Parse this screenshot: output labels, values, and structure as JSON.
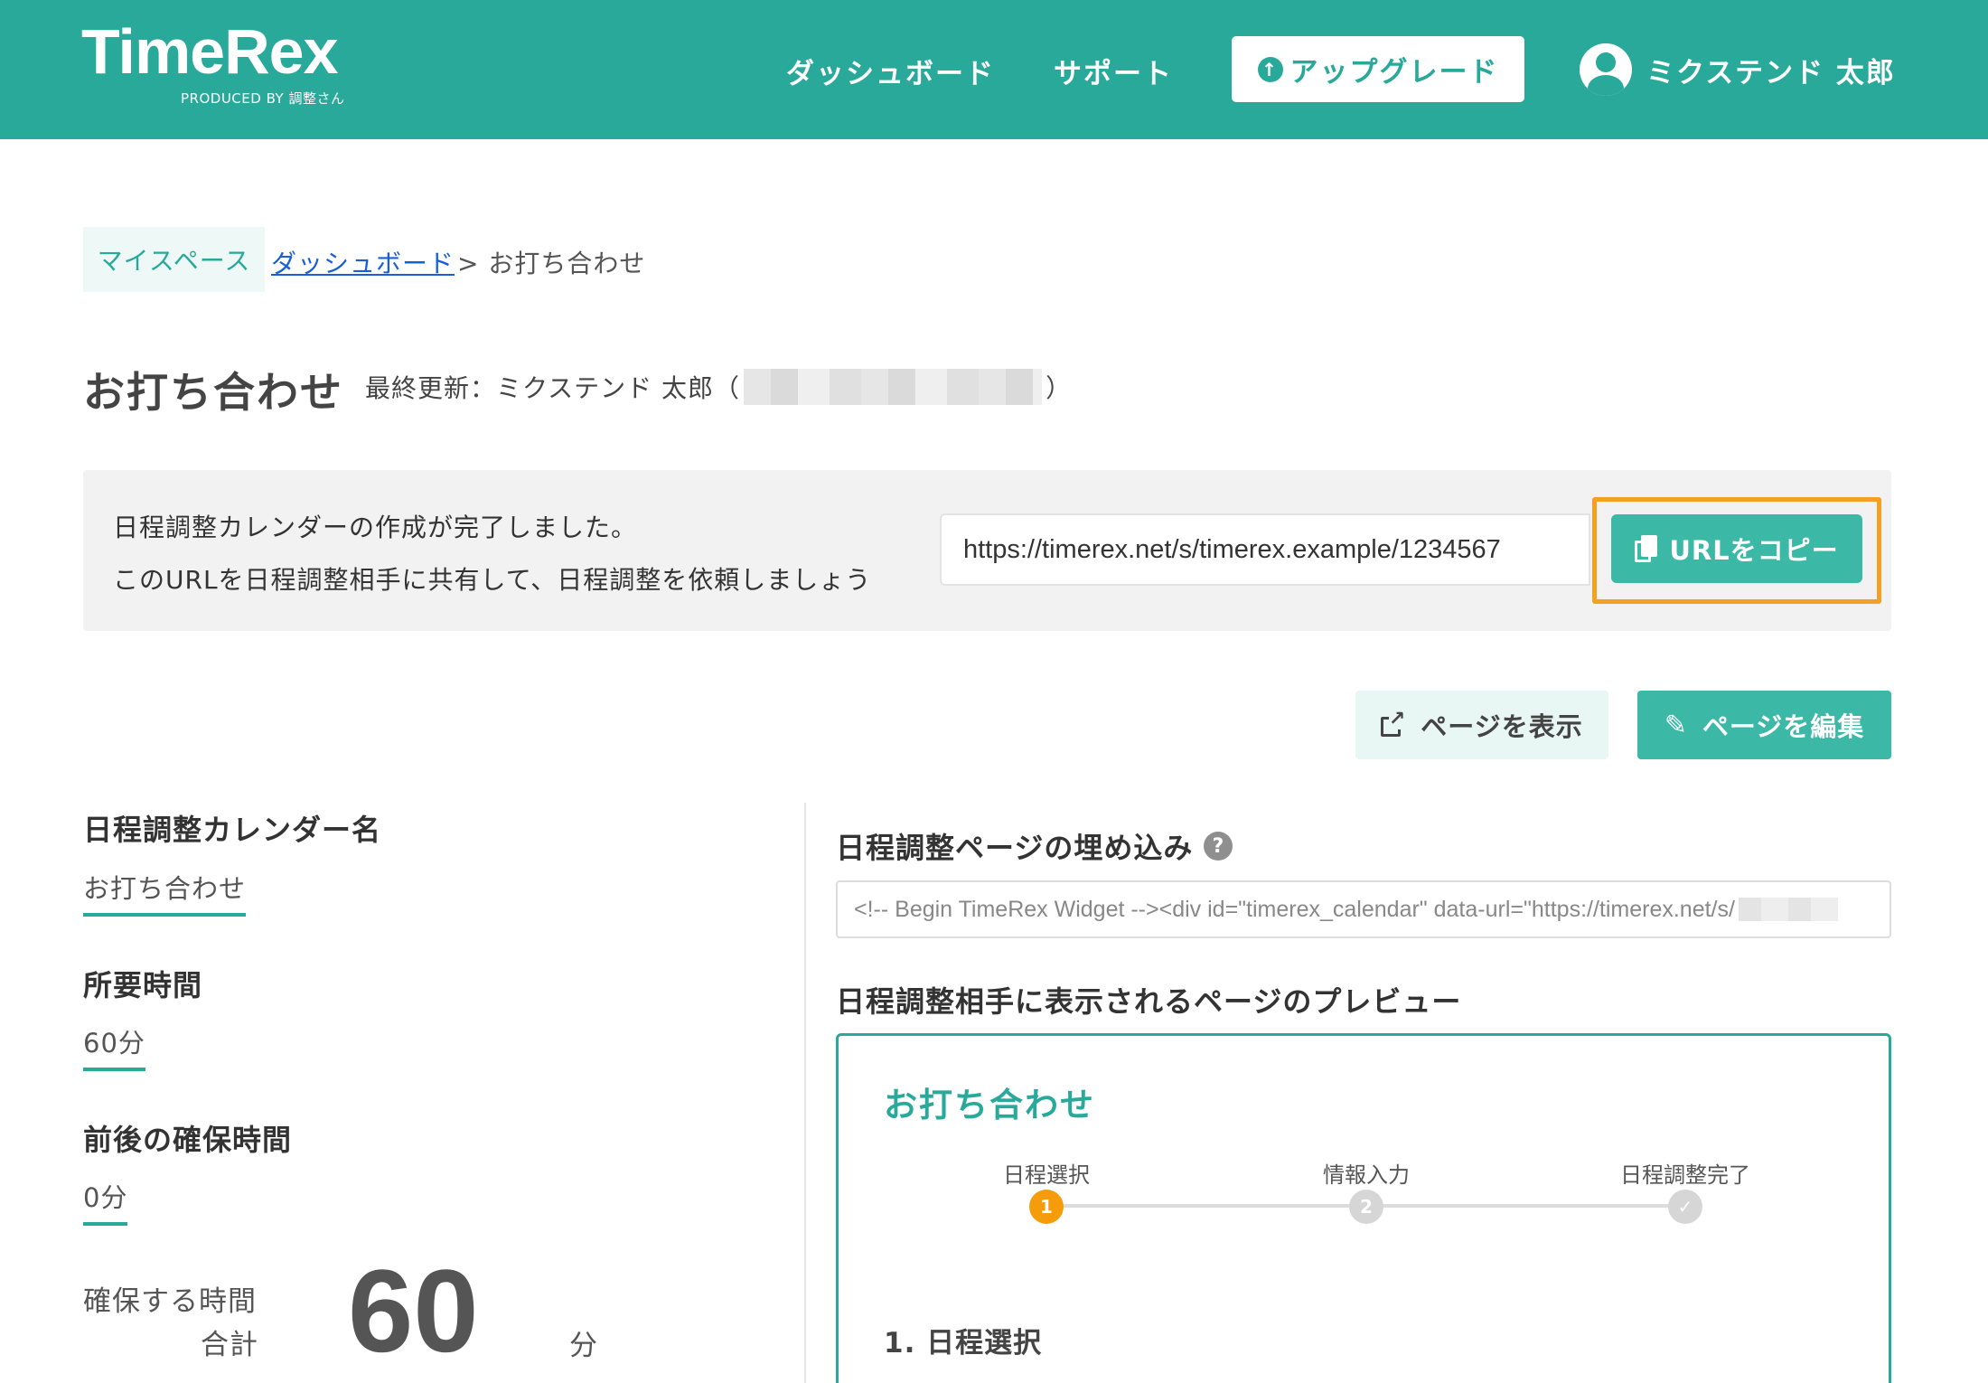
{
  "header": {
    "logo": "TimeRex",
    "logo_sub": "PRODUCED BY 調整さん",
    "nav": [
      "ダッシュボード",
      "サポート"
    ],
    "upgrade_label": "アップグレード",
    "user_name": "ミクステンド 太郎",
    "accent_color": "#28a99a"
  },
  "breadcrumb": {
    "home": "マイスペース",
    "link": "ダッシュボード",
    "rest": "> お打ち合わせ"
  },
  "page": {
    "title": "お打ち合わせ",
    "last_updated_prefix": "最終更新：ミクステンド 太郎（",
    "last_updated_suffix": "）"
  },
  "notice": {
    "line1": "日程調整カレンダーの作成が完了しました。",
    "line2": "このURLを日程調整相手に共有して、日程調整を依頼しましょう",
    "url": "https://timerex.net/s/timerex.example/1234567",
    "copy_label": "URLをコピー",
    "highlight_color": "#f4a020"
  },
  "actions": {
    "view_label": "ページを表示",
    "edit_label": "ページを編集"
  },
  "settings": {
    "calendar_name_label": "日程調整カレンダー名",
    "calendar_name_value": "お打ち合わせ",
    "duration_label": "所要時間",
    "duration_value": "60分",
    "buffer_label": "前後の確保時間",
    "buffer_value": "0分",
    "total_label_1": "確保する時間",
    "total_label_2": "合計",
    "total_value": "60",
    "total_unit": "分"
  },
  "embed": {
    "title": "日程調整ページの埋め込み",
    "help": "?",
    "code": "<!-- Begin TimeRex Widget --><div id=\"timerex_calendar\" data-url=\"https://timerex.net/s/"
  },
  "preview": {
    "heading": "日程調整相手に表示されるページのプレビュー",
    "title": "お打ち合わせ",
    "steps": [
      {
        "label": "日程選択",
        "marker": "1"
      },
      {
        "label": "情報入力",
        "marker": "2"
      },
      {
        "label": "日程調整完了",
        "marker": "✓"
      }
    ],
    "section": "1. 日程選択"
  }
}
